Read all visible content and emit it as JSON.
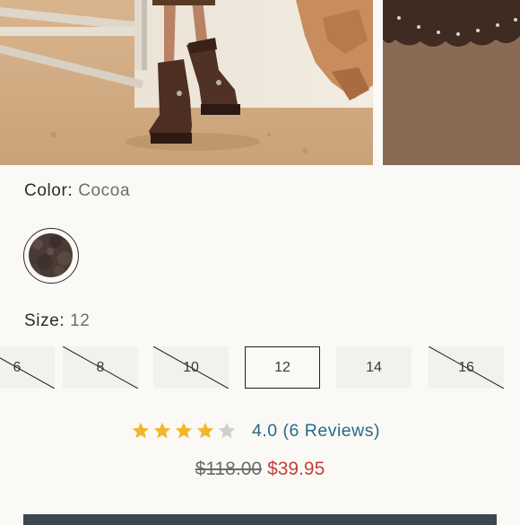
{
  "product": {
    "color_label": "Color:",
    "color_value": "Cocoa",
    "size_label": "Size:",
    "size_value": "12",
    "sizes": [
      {
        "label": "6",
        "available": false,
        "selected": false
      },
      {
        "label": "8",
        "available": false,
        "selected": false
      },
      {
        "label": "10",
        "available": false,
        "selected": false
      },
      {
        "label": "12",
        "available": true,
        "selected": true
      },
      {
        "label": "14",
        "available": true,
        "selected": false
      },
      {
        "label": "16",
        "available": false,
        "selected": false
      }
    ],
    "rating": {
      "score": 4.0,
      "max": 5,
      "text": "4.0 (6 Reviews)"
    },
    "price": {
      "original": "$118.00",
      "sale": "$39.95"
    }
  },
  "colors": {
    "star_filled": "#f0b72b",
    "star_empty": "#cfcfcf",
    "review_link": "#266a8c",
    "sale_price": "#c2413a",
    "cart_bar": "#3c4650"
  }
}
